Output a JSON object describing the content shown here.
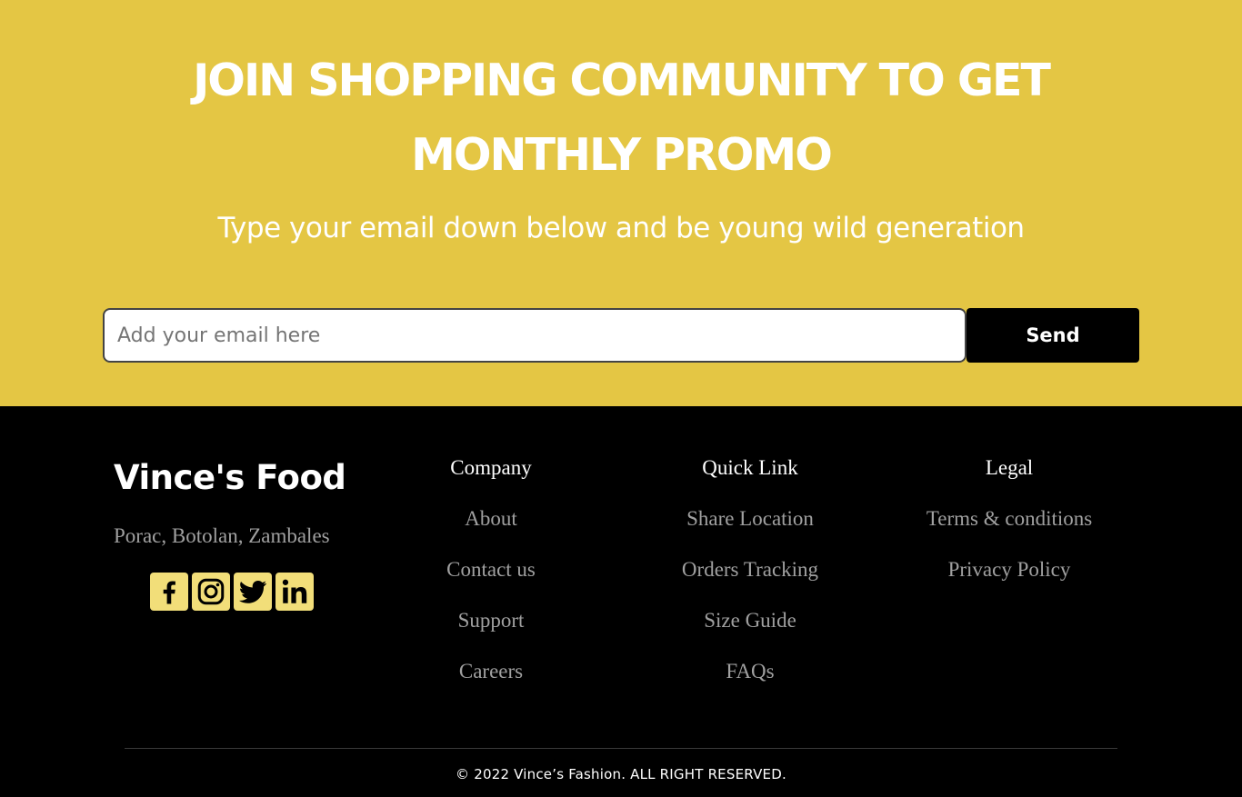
{
  "promo": {
    "title_line1": "JOIN SHOPPING COMMUNITY TO GET",
    "title_line2": "MONTHLY PROMO",
    "subtitle": "Type your email down below and be young wild generation",
    "email_placeholder": "Add your email here",
    "email_value": "",
    "send_label": "Send",
    "background_color": "#e4c644"
  },
  "footer": {
    "brand": "Vince's Food",
    "address": "Porac, Botolan, Zambales",
    "socials": [
      "facebook-icon",
      "instagram-icon",
      "twitter-icon",
      "linkedin-icon"
    ],
    "columns": {
      "company": {
        "title": "Company",
        "links": [
          "About",
          "Contact us",
          "Support",
          "Careers"
        ]
      },
      "quick": {
        "title": "Quick Link",
        "links": [
          "Share Location",
          "Orders Tracking",
          "Size Guide",
          "FAQs"
        ]
      },
      "legal": {
        "title": "Legal",
        "links": [
          "Terms & conditions",
          "Privacy Policy"
        ]
      }
    },
    "copyright": "© 2022 Vince’s Fashion. ALL RIGHT RESERVED."
  }
}
